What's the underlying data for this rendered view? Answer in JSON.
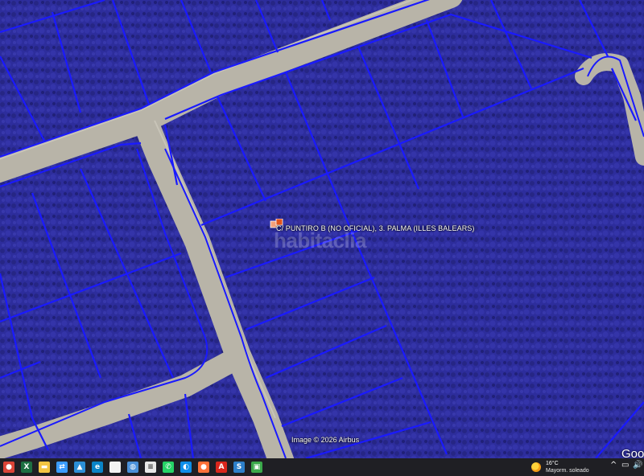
{
  "map": {
    "placemark_label": "C/ PUNTIRO B (NO OFICIAL), 3. PALMA (ILLES BALEARS)",
    "watermark": "habitaclia",
    "attribution": "Image © 2026 Airbus",
    "logo_text": "Goo",
    "parcel_line_color": "#1a1aff",
    "road_color": "#b8b4a8",
    "vegetation_tint": "#2d2d9c"
  },
  "taskbar": {
    "icons": [
      {
        "name": "chrome-icon",
        "color": "#db4437",
        "glyph": "●"
      },
      {
        "name": "excel-icon",
        "color": "#1d6f42",
        "glyph": "X"
      },
      {
        "name": "file-explorer-icon",
        "color": "#f4c542",
        "glyph": "▬"
      },
      {
        "name": "network-icon",
        "color": "#3a9cff",
        "glyph": "⇄"
      },
      {
        "name": "photos-icon",
        "color": "#2b8fd6",
        "glyph": "▲"
      },
      {
        "name": "edge-icon",
        "color": "#0a84c7",
        "glyph": "e"
      },
      {
        "name": "document-icon",
        "color": "#f2f2f2",
        "glyph": ""
      },
      {
        "name": "google-earth-icon",
        "color": "#4a90d9",
        "glyph": "◍"
      },
      {
        "name": "notepad-icon",
        "color": "#e8e8e8",
        "glyph": "≡"
      },
      {
        "name": "whatsapp-icon",
        "color": "#25d366",
        "glyph": "✆"
      },
      {
        "name": "teamviewer-icon",
        "color": "#0e8ee9",
        "glyph": "◐"
      },
      {
        "name": "firefox-icon",
        "color": "#ff7139",
        "glyph": "●"
      },
      {
        "name": "acrobat-icon",
        "color": "#d9261c",
        "glyph": "A"
      },
      {
        "name": "sharex-icon",
        "color": "#2d7fc9",
        "glyph": "S"
      },
      {
        "name": "greenshot-icon",
        "color": "#3aa84a",
        "glyph": "▣"
      }
    ],
    "weather_temp": "16°C",
    "weather_desc": "Mayorm. soleado",
    "tray": [
      "^",
      "▭",
      "🔊"
    ]
  }
}
